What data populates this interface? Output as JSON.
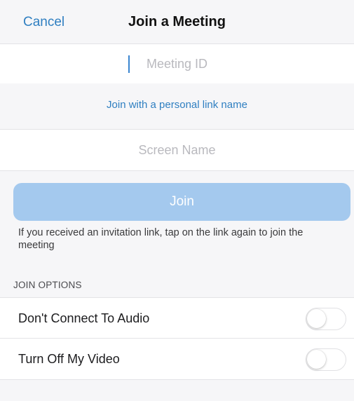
{
  "nav": {
    "cancel_label": "Cancel",
    "title": "Join a Meeting"
  },
  "form": {
    "meeting_id": {
      "value": "",
      "placeholder": "Meeting ID"
    },
    "personal_link_label": "Join with a personal link name",
    "screen_name": {
      "value": "",
      "placeholder": "Screen Name"
    },
    "join_label": "Join",
    "join_enabled": false,
    "hint": "If you received an invitation link, tap on the link again to join the meeting"
  },
  "options": {
    "header": "JOIN OPTIONS",
    "items": [
      {
        "label": "Don't Connect To Audio",
        "enabled": false
      },
      {
        "label": "Turn Off My Video",
        "enabled": false
      }
    ]
  },
  "colors": {
    "accent": "#2f7fc1",
    "join_disabled": "#a4c9ee",
    "background": "#f6f6f8"
  }
}
